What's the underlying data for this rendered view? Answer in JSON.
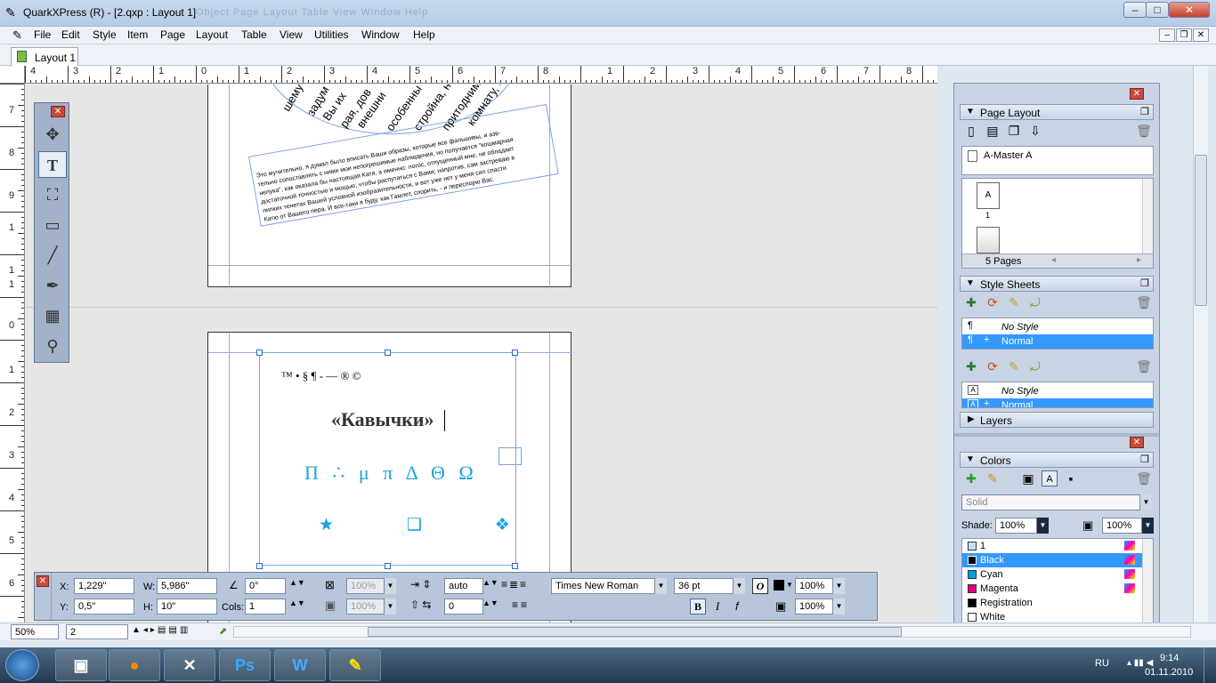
{
  "window": {
    "title": "QuarkXPress (R) - [2.qxp : Layout 1]",
    "faded_menu": "Object   Page   Layout   Table   View   Window   Help",
    "min": "–",
    "max": "□",
    "close": "✕"
  },
  "menu": [
    "File",
    "Edit",
    "Style",
    "Item",
    "Page",
    "Layout",
    "Table",
    "View",
    "Utilities",
    "Window",
    "Help"
  ],
  "tab": "Layout 1",
  "ruler_h": [
    "4",
    "3",
    "2",
    "1",
    "0",
    "1",
    "2",
    "3",
    "4",
    "5",
    "6",
    "7",
    "8",
    "1",
    "2",
    "3",
    "4",
    "5",
    "6",
    "7",
    "8",
    "9"
  ],
  "ruler_v": [
    "7",
    "8",
    "9",
    "1",
    "1",
    "1",
    "0",
    "1",
    "2",
    "3",
    "4",
    "5",
    "6"
  ],
  "ruler_v2": [
    "0",
    "1"
  ],
  "page_text": {
    "circle_words": [
      "шему",
      "задум",
      "Вы их",
      "рая, дов",
      "внешни",
      "особенны",
      "стройна, н",
      "притоднима",
      "комнату, С"
    ],
    "lines": [
      "Это мучительно, я думал было вписать Ваши образы, которые все фальшивы, и азв-",
      "тельно сопоставлять с ними мои непогрешимые наблюдения, но получается \"кошмарная",
      "нелука\", как оказала бы настоящая Катя, а именно: логос, отпущенный мне, не обладает",
      "достаточной точностью и мощью, чтобы распутаться с Вами; напротив, сам застреваю в",
      "липких тенетах Вашей условной изобразительности, и вот уже нет у меня сил спасти",
      "Катю от Вашего пера. И все-таки я буду, как Гамлет, спорить, - и переспорю Вас."
    ],
    "symbols": "™ • § ¶ - — ® ©",
    "heading": "«Кавычки»",
    "greek": "Π ∴ μ π Δ Θ Ω",
    "dingbats": "★   ❑   ❖"
  },
  "tools": [
    "move-icon",
    "text-icon",
    "picture-content-icon",
    "box-icon",
    "line-icon",
    "pen-icon",
    "table-icon",
    "zoom-icon"
  ],
  "measure": {
    "x_label": "X:",
    "x": "1,229\"",
    "y_label": "Y:",
    "y": "0,5\"",
    "w_label": "W:",
    "w": "5,986\"",
    "h_label": "H:",
    "h": "10\"",
    "angle": "0°",
    "cols_label": "Cols:",
    "cols": "1",
    "opacity1": "100%",
    "opacity2": "100%",
    "leading": "auto",
    "tracking": "0",
    "font": "Times New Roman",
    "size": "36 pt",
    "shade1": "100%",
    "shade2": "100%",
    "bold": "B",
    "italic": "I",
    "fx": "𝑓"
  },
  "page_layout": {
    "title": "Page Layout",
    "master": "A-Master A",
    "page_label": "A",
    "page_num": "1",
    "pages": "5 Pages"
  },
  "style_sheets": {
    "title": "Style Sheets",
    "para": [
      "No Style",
      "Normal"
    ],
    "char": [
      "No Style",
      "Normal"
    ]
  },
  "layers": {
    "title": "Layers"
  },
  "colors": {
    "title": "Colors",
    "fill": "Solid",
    "shade_label": "Shade:",
    "shade": "100%",
    "opacity": "100%",
    "list": [
      {
        "name": "1",
        "swatch": "#bfe4f5"
      },
      {
        "name": "Black",
        "swatch": "#000000"
      },
      {
        "name": "Cyan",
        "swatch": "#00a0e0"
      },
      {
        "name": "Magenta",
        "swatch": "#e0007a"
      },
      {
        "name": "Registration",
        "swatch": "#000000"
      },
      {
        "name": "White",
        "swatch": "#ffffff"
      }
    ]
  },
  "status": {
    "zoom": "50%",
    "page": "2"
  },
  "taskbar": {
    "lang": "RU",
    "time": "9:14",
    "date": "01.11.2010",
    "apps": [
      "save-icon",
      "firefox-icon",
      "xbox-icon",
      "photoshop-icon",
      "word-icon",
      "quark-icon"
    ],
    "ps": "Ps",
    "w": "W"
  }
}
